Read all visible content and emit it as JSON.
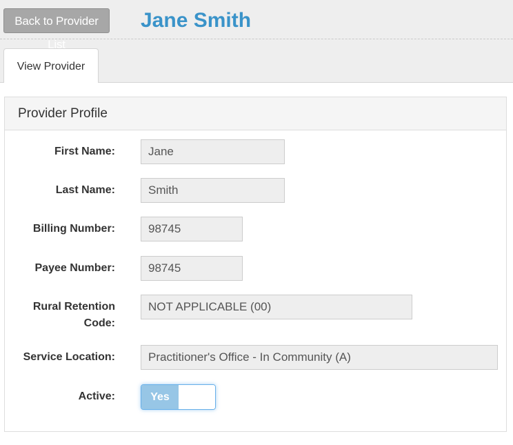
{
  "header": {
    "back_label": "Back to Provider List",
    "title": "Jane Smith"
  },
  "tabs": [
    {
      "label": "View Provider",
      "active": true
    }
  ],
  "panel": {
    "title": "Provider Profile"
  },
  "fields": {
    "first_name": {
      "label": "First Name:",
      "value": "Jane"
    },
    "last_name": {
      "label": "Last Name:",
      "value": "Smith"
    },
    "billing_number": {
      "label": "Billing Number:",
      "value": "98745"
    },
    "payee_number": {
      "label": "Payee Number:",
      "value": "98745"
    },
    "rural_retention": {
      "label_line1": "Rural Retention",
      "label_line2": "Code:",
      "value": "NOT APPLICABLE (00)"
    },
    "service_location": {
      "label": "Service Location:",
      "value": "Practitioner's Office - In Community (A)"
    },
    "active": {
      "label": "Active:",
      "value": "Yes",
      "on": true
    }
  },
  "colors": {
    "title": "#3a93c9",
    "toggle_on": "#97c6e6",
    "button": "#a7a7a7"
  }
}
